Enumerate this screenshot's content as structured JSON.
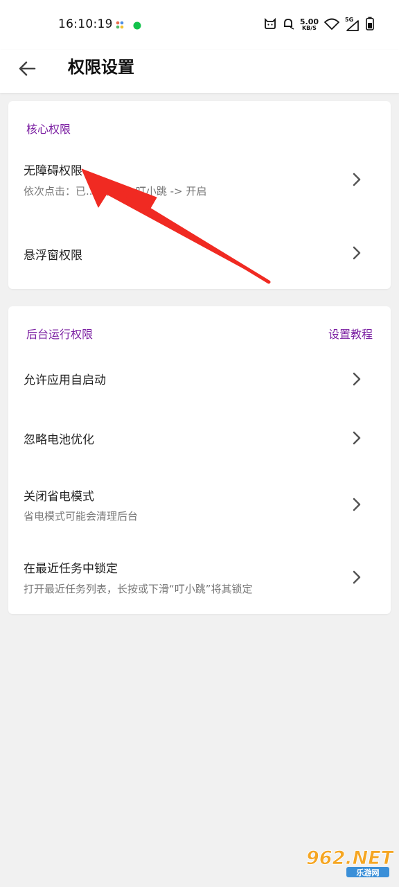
{
  "status_bar": {
    "time": "16:10:19",
    "net_speed_value": "5.00",
    "net_speed_unit": "KB/S",
    "signal_label": "5G"
  },
  "header": {
    "title": "权限设置"
  },
  "core_section": {
    "title": "核心权限",
    "items": [
      {
        "title": "无障碍权限",
        "subtitle": "依次点击：已...服务 -> 叮小跳 -> 开启"
      },
      {
        "title": "悬浮窗权限"
      }
    ]
  },
  "background_section": {
    "title": "后台运行权限",
    "action": "设置教程",
    "items": [
      {
        "title": "允许应用自启动"
      },
      {
        "title": "忽略电池优化"
      },
      {
        "title": "关闭省电模式",
        "subtitle": "省电模式可能会清理后台"
      },
      {
        "title": "在最近任务中锁定",
        "subtitle": "打开最近任务列表，长按或下滑“叮小跳”将其锁定"
      }
    ]
  },
  "watermark": {
    "text": "962.NET",
    "subtext": "乐游网"
  },
  "colors": {
    "accent": "#7b1fa2",
    "arrow": "#f02a22"
  }
}
